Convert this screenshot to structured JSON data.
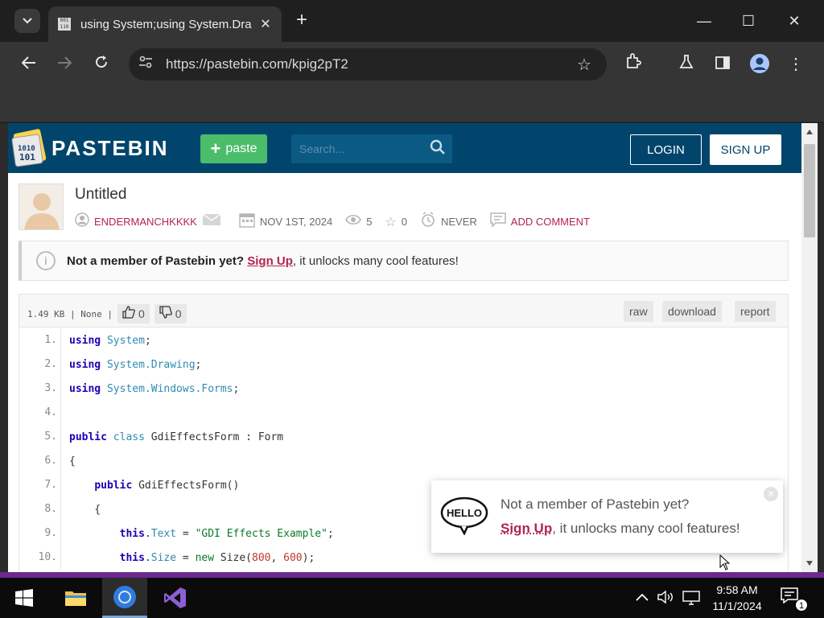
{
  "browser": {
    "tab_title": "using System;using System.Dra",
    "url": "https://pastebin.com/kpig2pT2",
    "tab_dropdown_icon": "chevron-down-icon",
    "new_tab_label": "+"
  },
  "header": {
    "brand": "PASTEBIN",
    "paste_label": "paste",
    "search_placeholder": "Search...",
    "login_label": "LOGIN",
    "signup_label": "SIGN UP"
  },
  "paste": {
    "title": "Untitled",
    "author": "ENDERMANCHKKKK",
    "date": "NOV 1ST, 2024",
    "views": "5",
    "stars": "0",
    "expiry": "NEVER",
    "add_comment": "ADD COMMENT"
  },
  "notice": {
    "bold": "Not a member of Pastebin yet?",
    "link": "Sign Up",
    "rest": ", it unlocks many cool features!"
  },
  "code_header": {
    "size": "1.49 KB",
    "sep1": "|",
    "syntax": "None",
    "sep2": "|",
    "likes": "0",
    "dislikes": "0",
    "raw": "raw",
    "download": "download",
    "report": "report"
  },
  "code_lines": [
    {
      "num": "1.",
      "tokens": [
        [
          "kw",
          "using"
        ],
        [
          "plain",
          " "
        ],
        [
          "ty",
          "System"
        ],
        [
          "plain",
          ";"
        ]
      ]
    },
    {
      "num": "2.",
      "tokens": [
        [
          "kw",
          "using"
        ],
        [
          "plain",
          " "
        ],
        [
          "ty",
          "System.Drawing"
        ],
        [
          "plain",
          ";"
        ]
      ]
    },
    {
      "num": "3.",
      "tokens": [
        [
          "kw",
          "using"
        ],
        [
          "plain",
          " "
        ],
        [
          "ty",
          "System.Windows.Forms"
        ],
        [
          "plain",
          ";"
        ]
      ]
    },
    {
      "num": "4.",
      "tokens": []
    },
    {
      "num": "5.",
      "tokens": [
        [
          "kw",
          "public"
        ],
        [
          "plain",
          " "
        ],
        [
          "ty",
          "class"
        ],
        [
          "plain",
          " GdiEffectsForm : Form"
        ]
      ]
    },
    {
      "num": "6.",
      "tokens": [
        [
          "plain",
          "{"
        ]
      ]
    },
    {
      "num": "7.",
      "tokens": [
        [
          "plain",
          "    "
        ],
        [
          "kw",
          "public"
        ],
        [
          "plain",
          " GdiEffectsForm()"
        ]
      ]
    },
    {
      "num": "8.",
      "tokens": [
        [
          "plain",
          "    {"
        ]
      ]
    },
    {
      "num": "9.",
      "tokens": [
        [
          "plain",
          "        "
        ],
        [
          "kw",
          "this"
        ],
        [
          "plain",
          "."
        ],
        [
          "ty",
          "Text"
        ],
        [
          "plain",
          " = "
        ],
        [
          "st",
          "\"GDI Effects Example\""
        ],
        [
          "plain",
          ";"
        ]
      ]
    },
    {
      "num": "10.",
      "tokens": [
        [
          "plain",
          "        "
        ],
        [
          "kw",
          "this"
        ],
        [
          "plain",
          "."
        ],
        [
          "ty",
          "Size"
        ],
        [
          "plain",
          " = "
        ],
        [
          "st",
          "new"
        ],
        [
          "plain",
          " Size("
        ],
        [
          "nu",
          "800"
        ],
        [
          "plain",
          ", "
        ],
        [
          "nu",
          "600"
        ],
        [
          "plain",
          ");"
        ]
      ]
    }
  ],
  "popup": {
    "badge_text": "HELLO",
    "line1": "Not a member of Pastebin yet?",
    "link": "Sign Up",
    "line2_rest": ", it unlocks many cool features!"
  },
  "taskbar": {
    "time": "9:58 AM",
    "date": "11/1/2024",
    "notifications": "1"
  },
  "colors": {
    "pastebin_header": "#02456c",
    "paste_button": "#4bbd6a",
    "link_accent": "#b3244d"
  }
}
